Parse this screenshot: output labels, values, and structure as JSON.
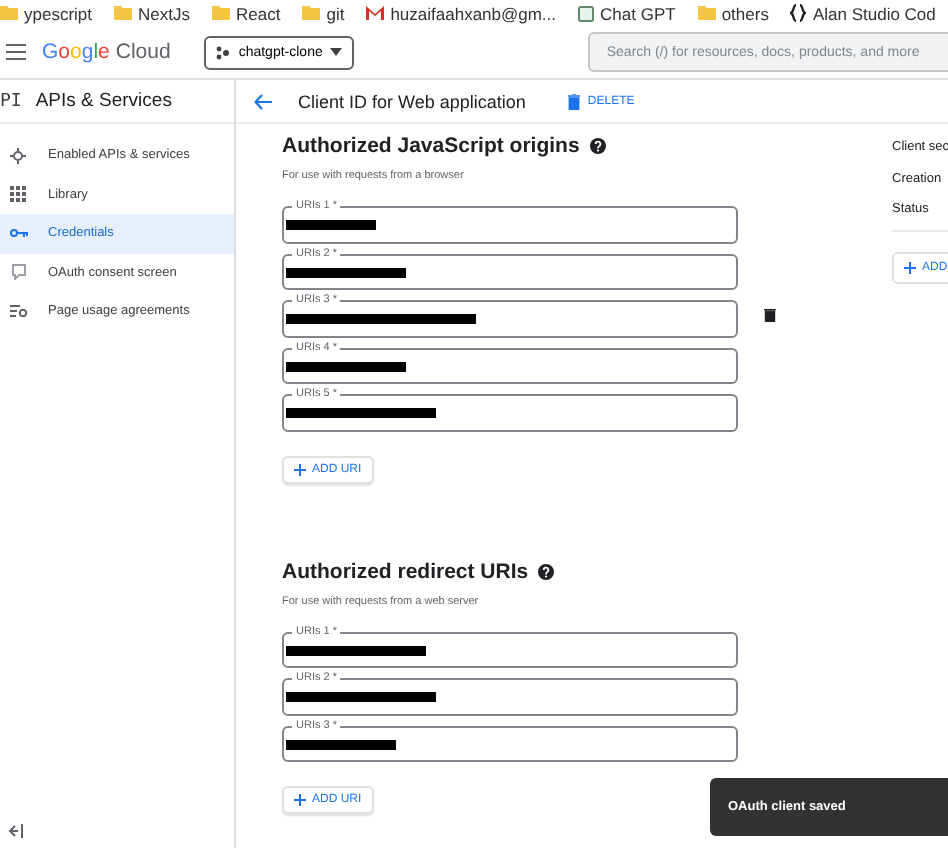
{
  "bookmarks": [
    {
      "label": "ypescript",
      "kind": "folder"
    },
    {
      "label": "NextJs",
      "kind": "folder"
    },
    {
      "label": "React",
      "kind": "folder"
    },
    {
      "label": "git",
      "kind": "folder"
    },
    {
      "label": "huzaifaahxanb@gm...",
      "kind": "mail"
    },
    {
      "label": "Chat GPT",
      "kind": "app"
    },
    {
      "label": "others",
      "kind": "folder"
    },
    {
      "label": "Alan Studio Cod",
      "kind": "code"
    }
  ],
  "topbar": {
    "logo_google": "Google",
    "logo_cloud": "Cloud",
    "project": "chatgpt-clone",
    "search": {
      "placeholder": "Search (/) for resources, docs, products, and more"
    }
  },
  "sidebar": {
    "badge": "PI",
    "title": "APIs & Services",
    "items": [
      {
        "label": "Enabled APIs & services",
        "kind": "enabled",
        "selected": false
      },
      {
        "label": "Library",
        "kind": "library",
        "selected": false
      },
      {
        "label": "Credentials",
        "kind": "credentials",
        "selected": true
      },
      {
        "label": "OAuth consent screen",
        "kind": "consent",
        "selected": false
      },
      {
        "label": "Page usage agreements",
        "kind": "agreements",
        "selected": false
      }
    ]
  },
  "header": {
    "title": "Client ID for Web application",
    "delete": "DELETE"
  },
  "sections": [
    {
      "title": "Authorized JavaScript origins",
      "subtitle": "For use with requests from a browser",
      "add_button": "ADD URI",
      "fields": [
        {
          "label": "URIs 1 *",
          "redacted": true,
          "delete_shown": false
        },
        {
          "label": "URIs 2 *",
          "redacted": true,
          "delete_shown": false
        },
        {
          "label": "URIs 3 *",
          "redacted": true,
          "delete_shown": true
        },
        {
          "label": "URIs 4 *",
          "redacted": true,
          "delete_shown": false
        },
        {
          "label": "URIs 5 *",
          "redacted": true,
          "delete_shown": false
        }
      ]
    },
    {
      "title": "Authorized redirect URIs",
      "subtitle": "For use with requests from a web server",
      "add_button": "ADD URI",
      "fields": [
        {
          "label": "URIs 1 *",
          "redacted": true,
          "delete_shown": false
        },
        {
          "label": "URIs 2 *",
          "redacted": true,
          "delete_shown": false
        },
        {
          "label": "URIs 3 *",
          "redacted": true,
          "delete_shown": false
        }
      ]
    }
  ],
  "details": {
    "rows": [
      "Client sec",
      "Creation",
      "Status"
    ],
    "add_button": "ADD"
  },
  "toast": {
    "message": "OAuth client saved"
  }
}
